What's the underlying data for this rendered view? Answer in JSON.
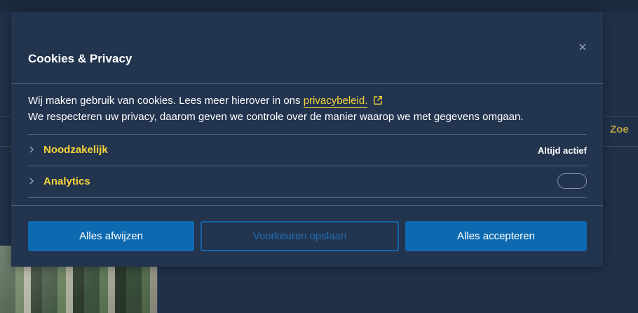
{
  "background": {
    "search_label": "Zoe"
  },
  "modal": {
    "title": "Cookies & Privacy",
    "close_icon": "close-icon",
    "description_line1_prefix": "Wij maken gebruik van cookies. Lees meer hierover in ons ",
    "privacy_link_text": "privacybeleid.",
    "external_link_icon": "external-link-icon",
    "description_line2": "We respecteren uw privacy, daarom geven we controle over de manier waarop we met gegevens omgaan.",
    "categories": [
      {
        "label": "Noodzakelijk",
        "status": "Altijd actief",
        "icon": "chevron-right-icon"
      },
      {
        "label": "Analytics",
        "toggle_on": false,
        "icon": "chevron-right-icon"
      }
    ],
    "buttons": {
      "reject_all": "Alles afwijzen",
      "save_preferences": "Voorkeuren opslaan",
      "accept_all": "Alles accepteren"
    }
  },
  "colors": {
    "page_bg": "#1f3048",
    "modal_bg": "#23344f",
    "accent_yellow": "#f5d43a",
    "primary_blue": "#0e6ab0"
  }
}
